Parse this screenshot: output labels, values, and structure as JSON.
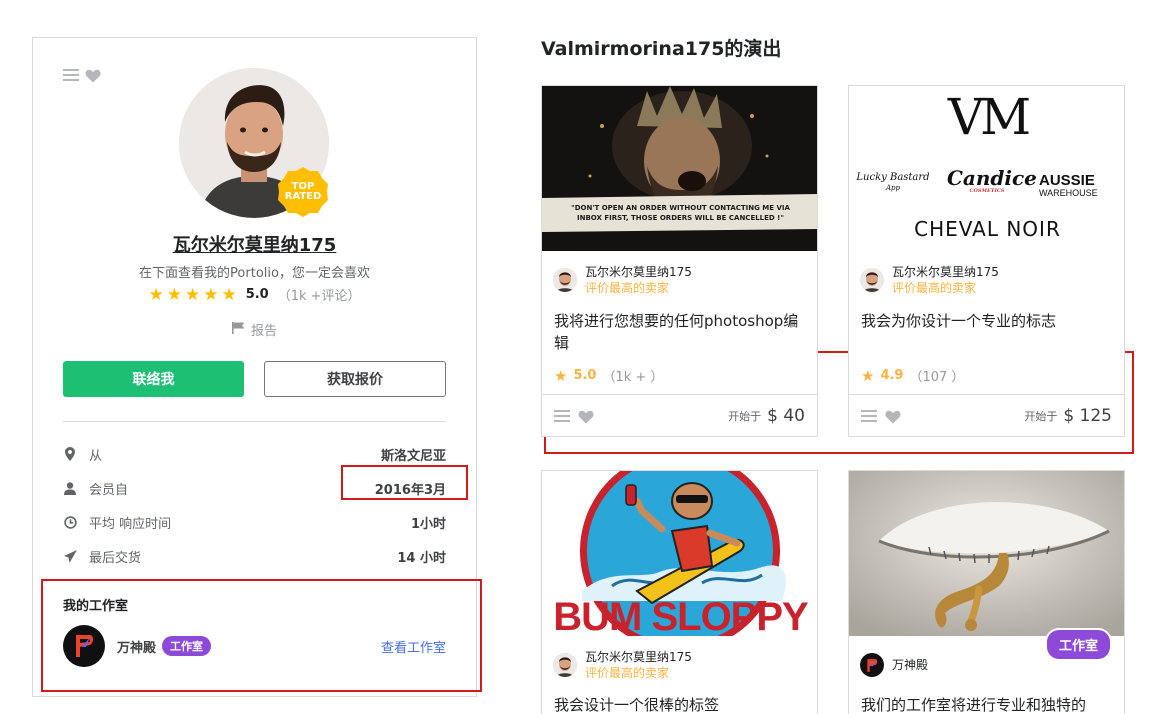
{
  "profile": {
    "name": "瓦尔米尔莫里纳175",
    "tagline": "在下面查看我的Portolio，您一定会喜欢",
    "top_rated_line1": "TOP",
    "top_rated_line2": "RATED",
    "rating_score": "5.0",
    "rating_count": "（1k +评论）",
    "report_label": "报告",
    "contact_button": "联络我",
    "quote_button": "获取报价",
    "stats": [
      {
        "icon": "location-pin-icon",
        "label": "从",
        "value": "斯洛文尼亚"
      },
      {
        "icon": "user-icon",
        "label": "会员自",
        "value": "2016年3月"
      },
      {
        "icon": "clock-icon",
        "label": "平均 响应时间",
        "value": "1小时"
      },
      {
        "icon": "paper-plane-icon",
        "label": "最后交货",
        "value": "14 小时"
      }
    ],
    "agency": {
      "title": "我的工作室",
      "name": "万神殿",
      "badge": "工作室",
      "link": "查看工作室"
    }
  },
  "gigs_section": {
    "title": "Valmirmorina175的演出",
    "gigs": [
      {
        "image_text": "\"DON'T OPEN AN ORDER WITHOUT CONTACTING ME VIA INBOX FIRST, THOSE ORDERS WILL BE CANCELLED !\"",
        "seller_name": "瓦尔米尔莫里纳175",
        "seller_level": "评价最高的卖家",
        "description": "我将进行您想要的任何photoshop编辑",
        "rating": "5.0",
        "rating_count": "（1k + ）",
        "price_label": "开始于",
        "price": "$ 40"
      },
      {
        "image_text": {
          "monogram": "VM",
          "logo1": "Lucky Bastard",
          "logo1_sub": "App",
          "logo2": "Candice",
          "logo2_sub": "COSMETICS",
          "logo3": "AUSSIE",
          "logo3_sub": "WAREHOUSE",
          "logo4": "CHEVAL NOIR"
        },
        "seller_name": "瓦尔米尔莫里纳175",
        "seller_level": "评价最高的卖家",
        "description": "我会为你设计一个专业的标志",
        "rating": "4.9",
        "rating_count": "（107 ）",
        "price_label": "开始于",
        "price": "$ 125"
      },
      {
        "image_text": "BUM SLOPPY",
        "seller_name": "瓦尔米尔莫里纳175",
        "seller_level": "评价最高的卖家",
        "description": "我会设计一个很棒的标签"
      },
      {
        "studio_badge": "工作室",
        "seller_name": "万神殿",
        "description": "我们的工作室将进行专业和独特的"
      }
    ]
  },
  "colors": {
    "accent_green": "#1dbf73",
    "star_yellow": "#ffbe00",
    "level_orange": "#ffb33e",
    "studio_purple": "#8d4ad9",
    "link_blue": "#446ee7",
    "highlight_red": "#d21a1a"
  }
}
